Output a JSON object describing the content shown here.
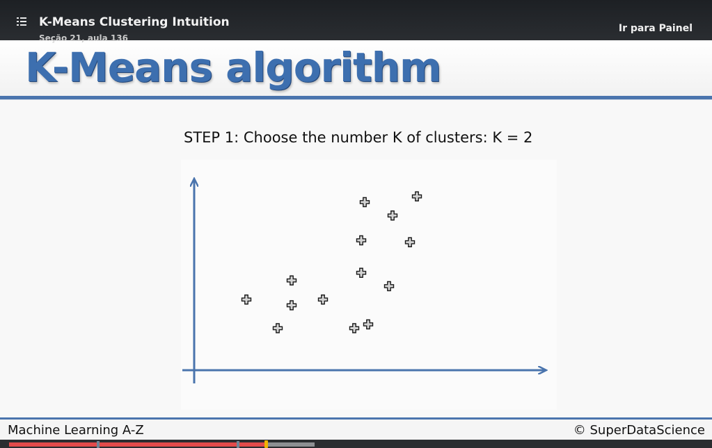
{
  "player": {
    "course_title": "K-Means Clustering Intuition",
    "lecture_subtitle": "Seção 21, aula 136",
    "dashboard_link": "Ir para Painel",
    "menu_icon": "list-icon"
  },
  "slide": {
    "title": "K-Means algorithm",
    "step_text": "STEP 1: Choose the number K of clusters: K = 2",
    "footer_left": "Machine Learning A-Z",
    "footer_right": "© SuperDataScience",
    "accent_color": "#3d6faf",
    "axis_color": "#4a74ad"
  },
  "chart_data": {
    "type": "scatter",
    "marker": "plus",
    "xlim": [
      0,
      100
    ],
    "ylim": [
      0,
      100
    ],
    "points": [
      {
        "x": 15,
        "y": 37
      },
      {
        "x": 24,
        "y": 22
      },
      {
        "x": 28,
        "y": 47
      },
      {
        "x": 28,
        "y": 34
      },
      {
        "x": 37,
        "y": 37
      },
      {
        "x": 46,
        "y": 22
      },
      {
        "x": 48,
        "y": 51
      },
      {
        "x": 50,
        "y": 24
      },
      {
        "x": 48,
        "y": 68
      },
      {
        "x": 49,
        "y": 88
      },
      {
        "x": 56,
        "y": 44
      },
      {
        "x": 57,
        "y": 81
      },
      {
        "x": 62,
        "y": 67
      },
      {
        "x": 64,
        "y": 91
      }
    ]
  },
  "progress": {
    "played_fraction": 0.37,
    "buffered_fraction": 0.44,
    "chapter_markers": [
      0.128,
      0.33
    ],
    "played_color": "#e24b4b",
    "handle_color": "#f0b400"
  }
}
